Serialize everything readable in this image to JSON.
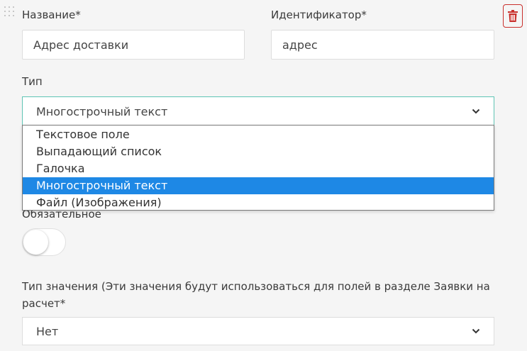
{
  "form": {
    "name_label": "Название*",
    "name_value": "Адрес доставки",
    "id_label": "Идентификатор*",
    "id_value": "адрес",
    "type_label": "Тип",
    "type_selected": "Многострочный текст",
    "type_options": [
      "Текстовое поле",
      "Выпадающий список",
      "Галочка",
      "Многострочный текст",
      "Файл (Изображения)"
    ],
    "required_label": "Обязательное",
    "required_on": false,
    "value_type_label_line1": "Тип значения (Эти значения будут использоваться для полей в разделе Заявки на",
    "value_type_label_line2": "расчет*",
    "value_type_selected": "Нет"
  },
  "icons": {
    "drag": "drag-handle-icon",
    "delete": "trash-icon",
    "chevron": "chevron-down-icon"
  },
  "colors": {
    "delete": "#c9302c",
    "focus_border": "#5ec4b4",
    "option_highlight": "#1e88e5"
  }
}
